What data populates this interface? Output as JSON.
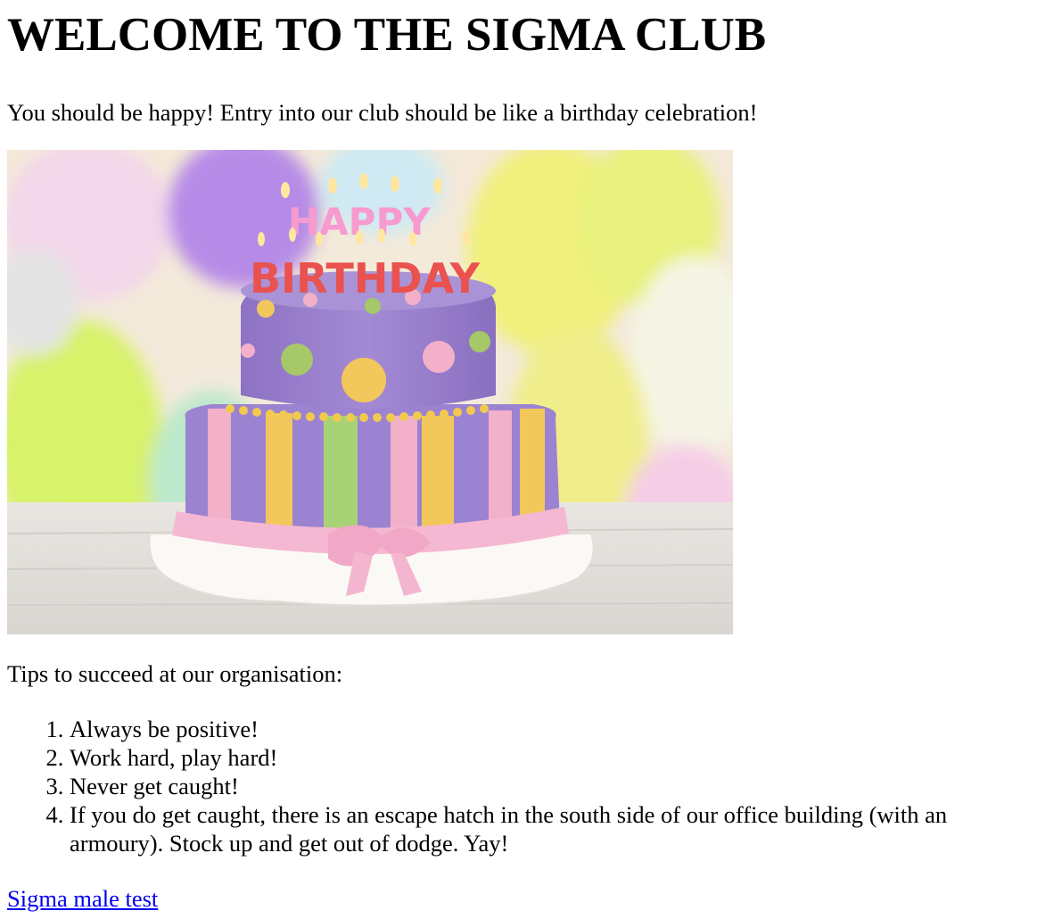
{
  "heading": "WELCOME TO THE SIGMA CLUB",
  "intro": "You should be happy! Entry into our club should be like a birthday celebration!",
  "image": {
    "subject": "birthday cake with balloons",
    "cake_lettering_line1": "HAPPY",
    "cake_lettering_line2": "BIRTHDAY",
    "colors": {
      "cake_purple": "#9a7fd0",
      "ribbon_pink": "#f3b3cd",
      "stripe_yellow": "#f2c75c",
      "stripe_green": "#a9d277",
      "balloon_yellow": "#f3f07e",
      "balloon_purple": "#b689e6"
    }
  },
  "tips_heading": "Tips to succeed at our organisation:",
  "tips": [
    "Always be positive!",
    "Work hard, play hard!",
    "Never get caught!",
    "If you do get caught, there is an escape hatch in the south side of our office building (with an armoury). Stock up and get out of dodge. Yay!"
  ],
  "link": {
    "label": "Sigma male test",
    "color": "#0000ee"
  }
}
